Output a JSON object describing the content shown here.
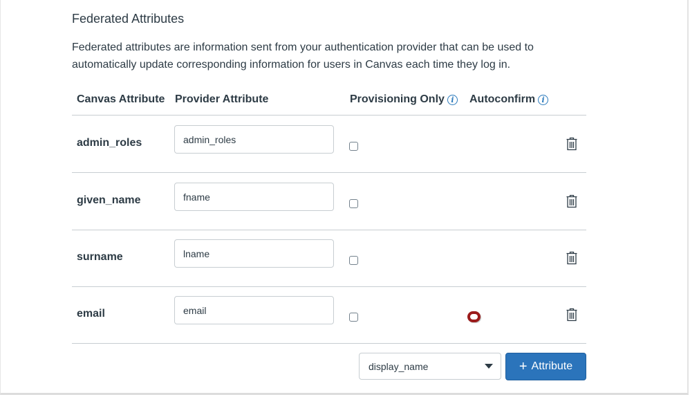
{
  "section": {
    "title": "Federated Attributes",
    "description": "Federated attributes are information sent from your authentication provider that can be used to automatically update corresponding information for users in Canvas each time they log in."
  },
  "table": {
    "headers": {
      "canvas_attribute": "Canvas Attribute",
      "provider_attribute": "Provider Attribute",
      "provisioning_only": "Provisioning Only",
      "autoconfirm": "Autoconfirm"
    },
    "info_icon_glyph": "i",
    "rows": [
      {
        "canvas_attribute": "admin_roles",
        "provider_attribute": "admin_roles",
        "provisioning_only": false,
        "has_autoconfirm": false
      },
      {
        "canvas_attribute": "given_name",
        "provider_attribute": "fname",
        "provisioning_only": false,
        "has_autoconfirm": false
      },
      {
        "canvas_attribute": "surname",
        "provider_attribute": "lname",
        "provisioning_only": false,
        "has_autoconfirm": false
      },
      {
        "canvas_attribute": "email",
        "provider_attribute": "email",
        "provisioning_only": false,
        "has_autoconfirm": true,
        "autoconfirm": false
      }
    ]
  },
  "footer": {
    "attribute_select_value": "display_name",
    "add_button_icon": "+",
    "add_button_label": "Attribute"
  },
  "colors": {
    "accent": "#2b74bb",
    "info_icon": "#2b7abc",
    "autoconfirm_highlight": "#9b1b1b",
    "text": "#2d3b45",
    "border": "#c7cdd1"
  }
}
